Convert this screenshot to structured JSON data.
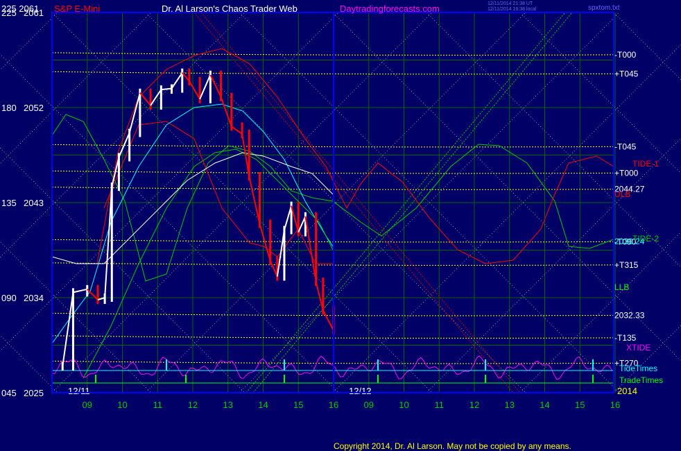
{
  "header": {
    "left_ticks": "225  2061",
    "title": "S&P E-Mini",
    "subtitle": "Dr. Al Larson's Chaos Trader Web",
    "website": "Daytradingforecasts.com",
    "timestamp1": "12/11/2014 21:38 UT",
    "timestamp2": "12/11/2014 16:38 local",
    "filename": "spxtom.txt"
  },
  "footer": {
    "copyright": "Copyright 2014, Dr. Al Larson. May not be copied by any means."
  },
  "colors": {
    "background": "#000066",
    "frame": "#0000ff",
    "grid": "#006600",
    "price_up": "#ffffff",
    "price_down": "#ff0000",
    "ma_cyan": "#00ffff",
    "ma_green": "#00cc00",
    "ma_red": "#ff0000",
    "ma_white": "#ffffff",
    "tide": "#ff00ff",
    "yellow": "#ffff00"
  },
  "chart_data": {
    "type": "line",
    "title": "S&P E-Mini",
    "ylabel_left_inner": [
      "2061",
      "2052",
      "2043",
      "2034",
      "2025"
    ],
    "ylabel_left_outer": [
      "225",
      "180",
      "135",
      "090",
      "045"
    ],
    "ylim": [
      2025,
      2061
    ],
    "x_day_labels": [
      "12/11",
      "12/12"
    ],
    "x_hours": [
      "09",
      "10",
      "11",
      "12",
      "13",
      "14",
      "15",
      "16",
      "09",
      "10",
      "11",
      "12",
      "13",
      "14",
      "15",
      "16"
    ],
    "year_label": "2014",
    "price_series": {
      "name": "S&P E-Mini",
      "x_hours": [
        8.3,
        8.6,
        9.0,
        9.3,
        9.5,
        9.7,
        9.9,
        10.2,
        10.5,
        10.8,
        11.1,
        11.4,
        11.7,
        11.9,
        12.2,
        12.5,
        12.8,
        13.1,
        13.4,
        13.6,
        13.9,
        14.2,
        14.4,
        14.6,
        14.8,
        15.0,
        15.2,
        15.5,
        15.7,
        16.0
      ],
      "values": [
        2027.5,
        2034.5,
        2034.8,
        2033.8,
        2034.0,
        2044.5,
        2047.3,
        2049.6,
        2053.4,
        2052.2,
        2053.7,
        2053.8,
        2055.3,
        2054.5,
        2052.8,
        2055.1,
        2053.0,
        2050.2,
        2049.5,
        2045.5,
        2041.0,
        2037.5,
        2036.0,
        2040.4,
        2042.7,
        2040.2,
        2041.7,
        2035.5,
        2032.8,
        2030.9
      ]
    },
    "levels": [
      {
        "label": "-T000",
        "value": 2057.0
      },
      {
        "label": "+T045",
        "value": 2055.2
      },
      {
        "label": "-T045",
        "value": 2048.3
      },
      {
        "label": "+T000",
        "value": 2045.8
      },
      {
        "label": "2044.27",
        "value": 2044.27
      },
      {
        "label": "-T090",
        "value": 2039.3
      },
      {
        "label": "+T315",
        "value": 2037.1
      },
      {
        "label": "2032.33",
        "value": 2032.33
      },
      {
        "label": "-T135",
        "value": 2030.2
      },
      {
        "label": "+T270",
        "value": 2027.8
      }
    ],
    "annotations": [
      "TIDE-1",
      "ULB",
      "TIDE-2",
      "2039.24",
      "LLB",
      "XTIDE",
      "TideTimes",
      "TradeTimes"
    ]
  }
}
